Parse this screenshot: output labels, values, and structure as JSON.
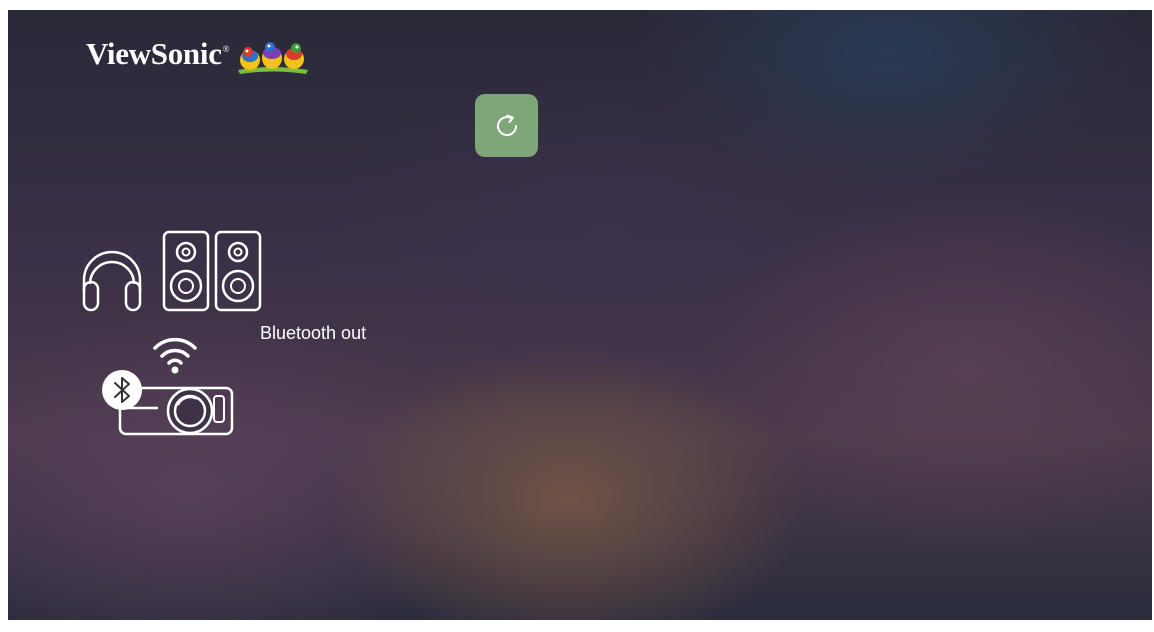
{
  "logo": {
    "brand": "ViewSonic",
    "registered_mark": "®"
  },
  "toolbar": {
    "refresh_icon": "refresh-icon",
    "accent_color": "#7ea678"
  },
  "bluetooth": {
    "label": "Bluetooth out",
    "icons": [
      "headphones-icon",
      "speakers-icon",
      "wifi-icon",
      "bluetooth-icon",
      "projector-icon"
    ]
  }
}
